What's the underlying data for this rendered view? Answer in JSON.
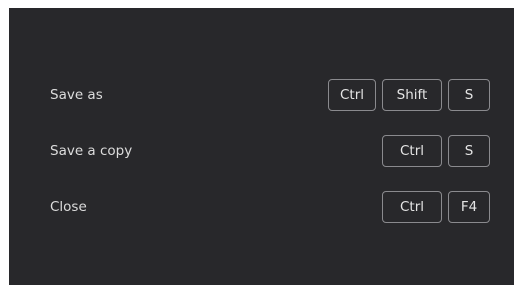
{
  "shortcuts": [
    {
      "label": "Save as",
      "keys": [
        "Ctrl",
        "Shift",
        "S"
      ]
    },
    {
      "label": "Save a copy",
      "keys": [
        "Ctrl",
        "S"
      ]
    },
    {
      "label": "Close",
      "keys": [
        "Ctrl",
        "F4"
      ]
    }
  ],
  "colors": {
    "panel_bg": "#28282b",
    "text": "#dcdcdc",
    "key_border": "#8a8a8e"
  }
}
